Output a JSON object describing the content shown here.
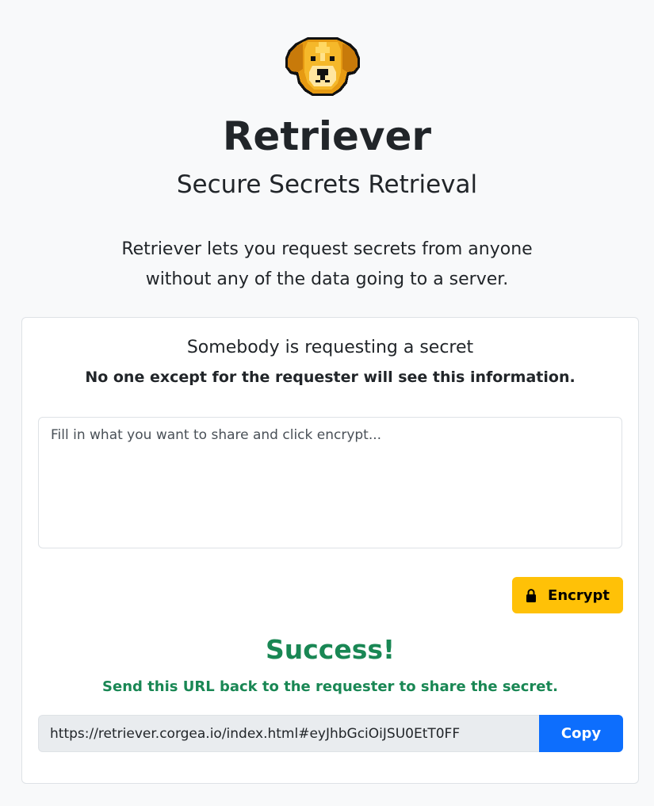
{
  "header": {
    "logo_icon": "retriever-dog-pixel-logo",
    "title": "Retriever",
    "subtitle": "Secure Secrets Retrieval",
    "intro_line_1": "Retriever lets you request secrets from anyone",
    "intro_line_2": "without any of the data going to a server."
  },
  "card": {
    "title": "Somebody is requesting a secret",
    "note": "No one except for the requester will see this information.",
    "secret_input": {
      "value": "",
      "placeholder": "Fill in what you want to share and click encrypt..."
    },
    "encrypt_button": {
      "icon": "lock-icon",
      "label": "Encrypt",
      "color": "#ffc107"
    },
    "success": {
      "title": "Success!",
      "message": "Send this URL back to the requester to share the secret.",
      "color": "#198754"
    },
    "share_url": {
      "value": "https://retriever.corgea.io/index.html#eyJhbGciOiJSU0EtT0FF"
    },
    "copy_button": {
      "label": "Copy",
      "color": "#0d6efd"
    }
  }
}
